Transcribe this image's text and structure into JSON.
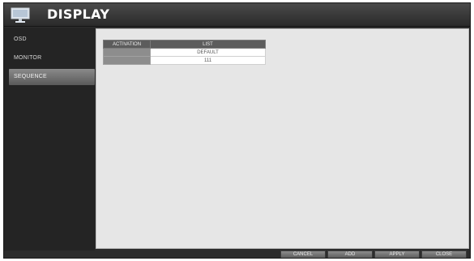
{
  "window": {
    "title": "DISPLAY"
  },
  "sidebar": {
    "items": [
      {
        "label": "OSD",
        "active": false
      },
      {
        "label": "MONITOR",
        "active": false
      },
      {
        "label": "SEQUENCE",
        "active": true
      }
    ]
  },
  "sequence_table": {
    "headers": {
      "activation": "ACTIVATION",
      "list": "LIST"
    },
    "rows": [
      {
        "activation": "",
        "list": "DEFAULT"
      },
      {
        "activation": "",
        "list": "111"
      }
    ]
  },
  "buttons": {
    "cancel": "CANCEL",
    "add": "ADD",
    "apply": "APPLY",
    "close": "CLOSE"
  }
}
